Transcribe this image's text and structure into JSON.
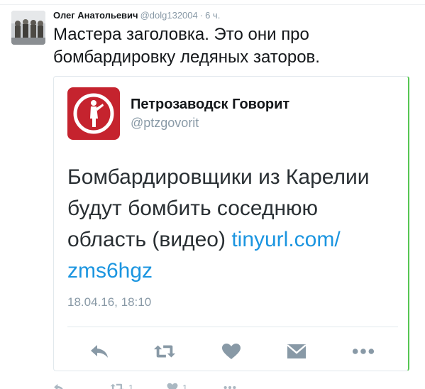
{
  "tweet": {
    "author_name": "Олег Анатольевич",
    "author_handle": "@dolg132004",
    "separator": "·",
    "time": "6 ч.",
    "text": "Мастера заголовка. Это они про\nбомбардировку ледяных заторов.",
    "retweet_count": "1",
    "like_count": "1"
  },
  "quoted": {
    "account_name": "Петрозаводск Говорит",
    "account_handle": "@ptzgovorit",
    "text_main": "Бомбардировщики из Карелии будут бомбить соседнюю область (видео) ",
    "text_link": "tinyurl.com/zms6hgz",
    "date": "18.04.16, 18:10"
  },
  "colors": {
    "link": "#1b95e0",
    "logo_bg": "#c5232e",
    "muted": "#8899a6",
    "card_accent": "#57c653"
  },
  "icons": {
    "reply": "reply-icon",
    "retweet": "retweet-icon",
    "like": "heart-icon",
    "message": "envelope-icon",
    "more": "more-dots-icon"
  }
}
